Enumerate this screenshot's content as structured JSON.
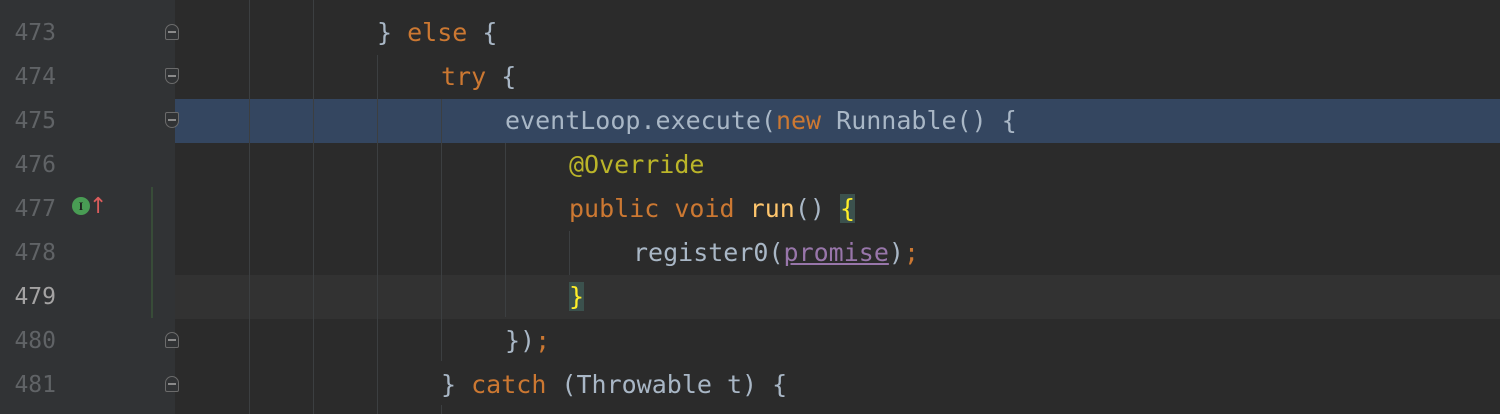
{
  "editor": {
    "lines": [
      {
        "number": "473",
        "tokens": [
          {
            "t": "} ",
            "c": ""
          },
          {
            "t": "else",
            "c": "kw"
          },
          {
            "t": " {",
            "c": ""
          }
        ]
      },
      {
        "number": "474",
        "tokens": [
          {
            "t": "try",
            "c": "kw"
          },
          {
            "t": " {",
            "c": ""
          }
        ]
      },
      {
        "number": "475",
        "tokens": [
          {
            "t": "eventLoop.execute(",
            "c": ""
          },
          {
            "t": "new",
            "c": "kw"
          },
          {
            "t": " Runnable() {",
            "c": ""
          }
        ]
      },
      {
        "number": "476",
        "tokens": [
          {
            "t": "@Override",
            "c": "ann"
          }
        ]
      },
      {
        "number": "477",
        "tokens": [
          {
            "t": "public",
            "c": "kw"
          },
          {
            "t": " ",
            "c": ""
          },
          {
            "t": "void",
            "c": "kw"
          },
          {
            "t": " ",
            "c": ""
          },
          {
            "t": "run",
            "c": "fn"
          },
          {
            "t": "() ",
            "c": ""
          },
          {
            "t": "{",
            "c": "brace-hl"
          }
        ]
      },
      {
        "number": "478",
        "tokens": [
          {
            "t": "register0(",
            "c": ""
          },
          {
            "t": "promise",
            "c": "field"
          },
          {
            "t": ")",
            "c": ""
          },
          {
            "t": ";",
            "c": "kw"
          }
        ]
      },
      {
        "number": "479",
        "tokens": [
          {
            "t": "}",
            "c": "brace-hl"
          }
        ]
      },
      {
        "number": "480",
        "tokens": [
          {
            "t": "})",
            "c": ""
          },
          {
            "t": ";",
            "c": "kw"
          }
        ]
      },
      {
        "number": "481",
        "tokens": [
          {
            "t": "} ",
            "c": ""
          },
          {
            "t": "catch",
            "c": "kw"
          },
          {
            "t": " (Throwable t) {",
            "c": ""
          }
        ]
      }
    ],
    "icons": {
      "implements": "implements-method-icon",
      "implements_letter": "I",
      "arrow": "go-to-super-arrow-icon"
    },
    "colors": {
      "background": "#2b2b2b",
      "gutter": "#313335",
      "selection": "#344660",
      "keyword": "#cc7832",
      "annotation": "#bbb529",
      "method": "#ffc66d",
      "field": "#9876aa",
      "text": "#a9b7c6"
    }
  }
}
